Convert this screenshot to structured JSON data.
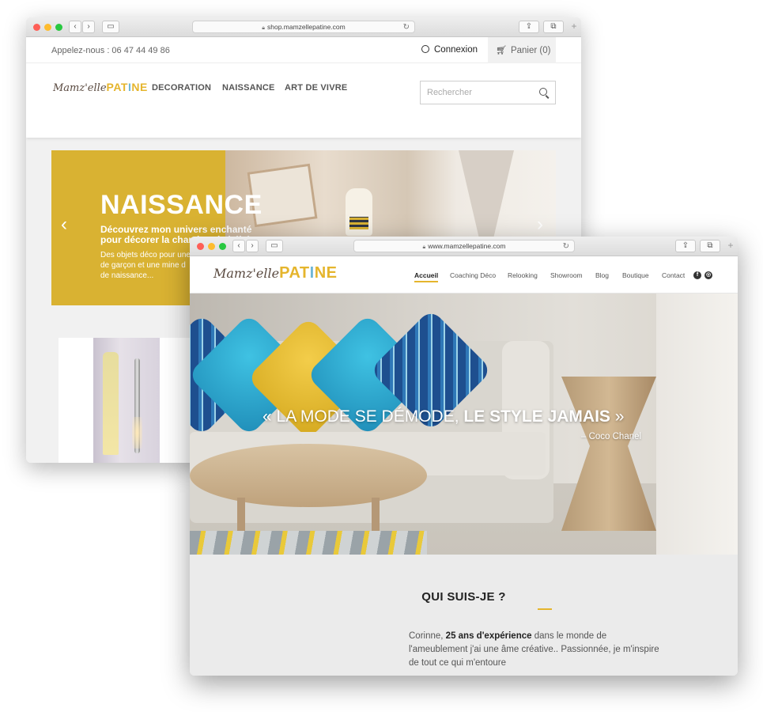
{
  "colors": {
    "accent_yellow": "#e5b52d",
    "accent_blue": "#6fb7d6",
    "hero_yellow": "#d9b232"
  },
  "shop_window": {
    "url": "shop.mamzellepatine.com",
    "phone": "Appelez-nous : 06 47 44 49 86",
    "login": "Connexion",
    "cart": "Panier (0)",
    "logo_script": "Mamz'elle",
    "logo_pa": "PAT",
    "logo_i": "I",
    "logo_ne": "NE",
    "nav": [
      "DECORATION",
      "NAISSANCE",
      "ART DE VIVRE"
    ],
    "search_placeholder": "Rechercher",
    "hero_title": "NAISSANCE",
    "hero_subtitle_1": "Découvrez mon univers enchanté",
    "hero_subtitle_2": "pour décorer la chambre de bébé.",
    "hero_text_1": "Des objets déco pour une chambre de fille ou",
    "hero_text_2": "de garçon et une mine d",
    "hero_text_3": "de naissance...",
    "prev_arrow": "‹",
    "next_arrow": "›",
    "icons": {
      "user": "user-icon",
      "cart": "cart-icon",
      "search": "search-icon"
    }
  },
  "main_window": {
    "url": "www.mamzellepatine.com",
    "logo_script": "Mamz'elle",
    "logo_pa": "PAT",
    "logo_i": "I",
    "logo_ne": "NE",
    "nav": [
      "Accueil",
      "Coaching Déco",
      "Relooking",
      "Showroom",
      "Blog",
      "Boutique",
      "Contact"
    ],
    "social": [
      "f",
      "◎"
    ],
    "quote_open": "« LA MODE SE DÉMODE, ",
    "quote_bold": "LE STYLE JAMAIS",
    "quote_close": " »",
    "quote_author": "– Coco Chanel",
    "about_title": "QUI SUIS-JE ?",
    "about_name": "Corinne, ",
    "about_bold": "25 ans d'expérience",
    "about_text_1": " dans le monde de",
    "about_text_2": "l'ameublement j'ai une âme créative.. Passionnée, je m'inspire",
    "about_text_3": "de tout ce qui m'entoure"
  },
  "browser": {
    "back": "‹",
    "forward": "›",
    "reload": "↻",
    "share": "⇪",
    "tabs": "⧉",
    "new_tab": "+"
  }
}
